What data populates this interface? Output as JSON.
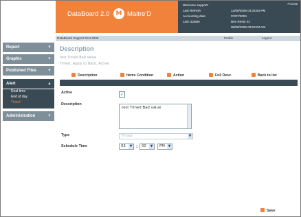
{
  "header": {
    "app_title": "DataBoard 2.0",
    "logo_glyph": "M",
    "product_name": "Maitre'D",
    "id_code": "PC0036",
    "info_rows": [
      {
        "label": "Welcome support!",
        "value": ""
      },
      {
        "label": "Last Refresh",
        "value": "12/06/2006 03:34:54 PM"
      },
      {
        "label": "Accounting date",
        "value": "07/07/2004"
      },
      {
        "label": "Last Update",
        "value": "Ben Resto 22"
      },
      {
        "label": "",
        "value": "08/08/2006 09:04:03 AM"
      }
    ]
  },
  "topbar": {
    "context": "DataBoard Support Test 2005",
    "profile": "Profile",
    "logout": "Logout"
  },
  "sidebar": {
    "report": "Report",
    "graphic": "Graphic",
    "published_files": "Published Files",
    "alert": "Alert",
    "alert_items": [
      "Real time",
      "End of day",
      "Timed"
    ],
    "administration": "Administration"
  },
  "main": {
    "title": "Description",
    "desc_line1": "test Timed Bad value",
    "desc_line2": "Timed, Apply to Back, Active",
    "tabs": [
      "Description",
      "Items Condition",
      "Action",
      "Full Desc.",
      "Back to list"
    ],
    "form": {
      "active_label": "Active",
      "active_checked": true,
      "description_label": "Description",
      "description_value": "test Timed Bad value",
      "type_label": "Type",
      "type_value": "Timed",
      "schedule_label": "Schedule Time",
      "hour": "03",
      "minute": "00",
      "ampm": "PM"
    },
    "save_label": "Save"
  },
  "colors": {
    "accent": "#f0823c",
    "dark": "#3a4a55",
    "nav": "#7e8f99"
  }
}
